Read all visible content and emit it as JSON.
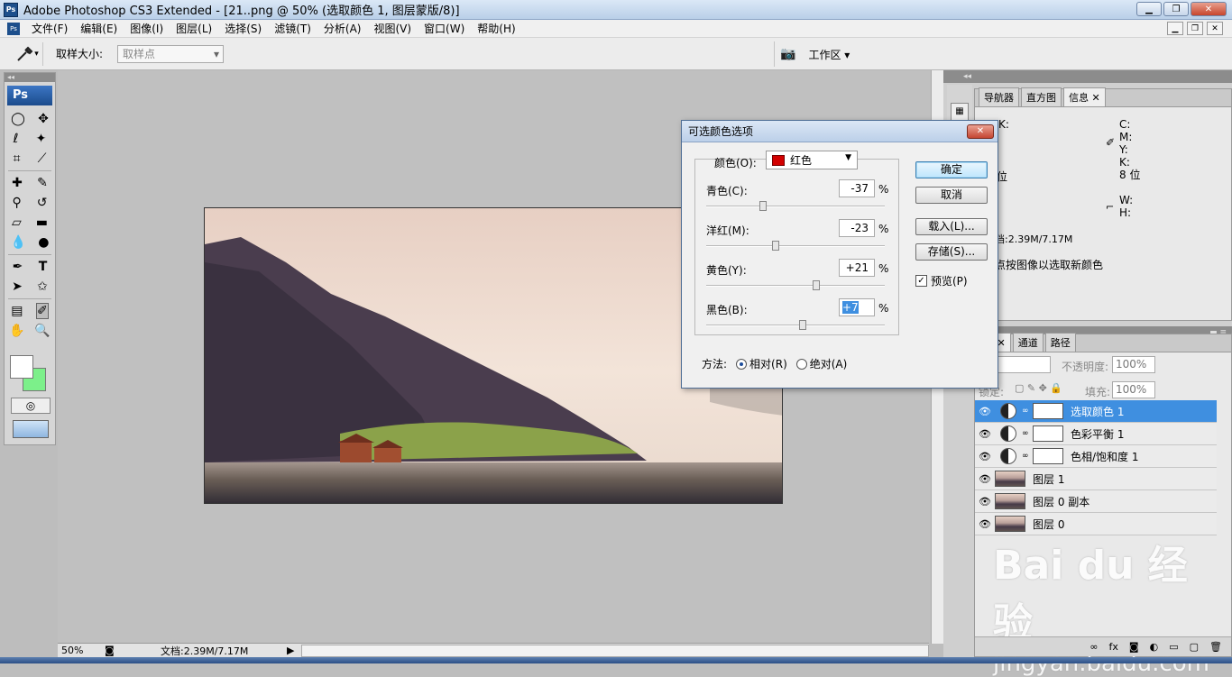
{
  "window": {
    "title": "Adobe Photoshop CS3 Extended - [21..png @ 50% (选取颜色 1, 图层蒙版/8)]"
  },
  "menu": [
    "文件(F)",
    "编辑(E)",
    "图像(I)",
    "图层(L)",
    "选择(S)",
    "滤镜(T)",
    "分析(A)",
    "视图(V)",
    "窗口(W)",
    "帮助(H)"
  ],
  "options": {
    "sample_label": "取样大小:",
    "sample_value": "取样点",
    "workspace": "工作区"
  },
  "status": {
    "zoom": "50%",
    "doc": "文档:2.39M/7.17M"
  },
  "info_panel": {
    "tabs": [
      "导航器",
      "直方图",
      "信息"
    ],
    "c": "C:",
    "m": "M:",
    "y": "Y:",
    "k": "K:",
    "bits_left": "位",
    "bits_right": "8 位",
    "w": "W:",
    "h": "H:",
    "doc": "档:2.39M/7.17M",
    "hint": "点按图像以选取新颜色",
    "k_left": "K:"
  },
  "layers_panel": {
    "tabs": [
      "层",
      "通道",
      "路径"
    ],
    "opacity_label": "不透明度:",
    "opacity": "100%",
    "fill_label": "填充:",
    "fill": "100%",
    "lock_label": "锁定:",
    "layers": [
      "选取颜色 1",
      "色彩平衡 1",
      "色相/饱和度 1",
      "图层 1",
      "图层 0 副本",
      "图层 0"
    ]
  },
  "dialog": {
    "title": "可选颜色选项",
    "color_label": "颜色(O):",
    "color_value": "红色",
    "sliders": [
      {
        "label": "青色(C):",
        "value": "-37"
      },
      {
        "label": "洋红(M):",
        "value": "-23"
      },
      {
        "label": "黄色(Y):",
        "value": "+21"
      },
      {
        "label": "黑色(B):",
        "value": "+7"
      }
    ],
    "pct": "%",
    "ok": "确定",
    "cancel": "取消",
    "load": "载入(L)...",
    "save": "存储(S)...",
    "preview": "预览(P)",
    "method_label": "方法:",
    "relative": "相对(R)",
    "absolute": "绝对(A)"
  },
  "watermark": {
    "brand": "Bai du 经验",
    "url": "jingyan.baidu.com"
  }
}
